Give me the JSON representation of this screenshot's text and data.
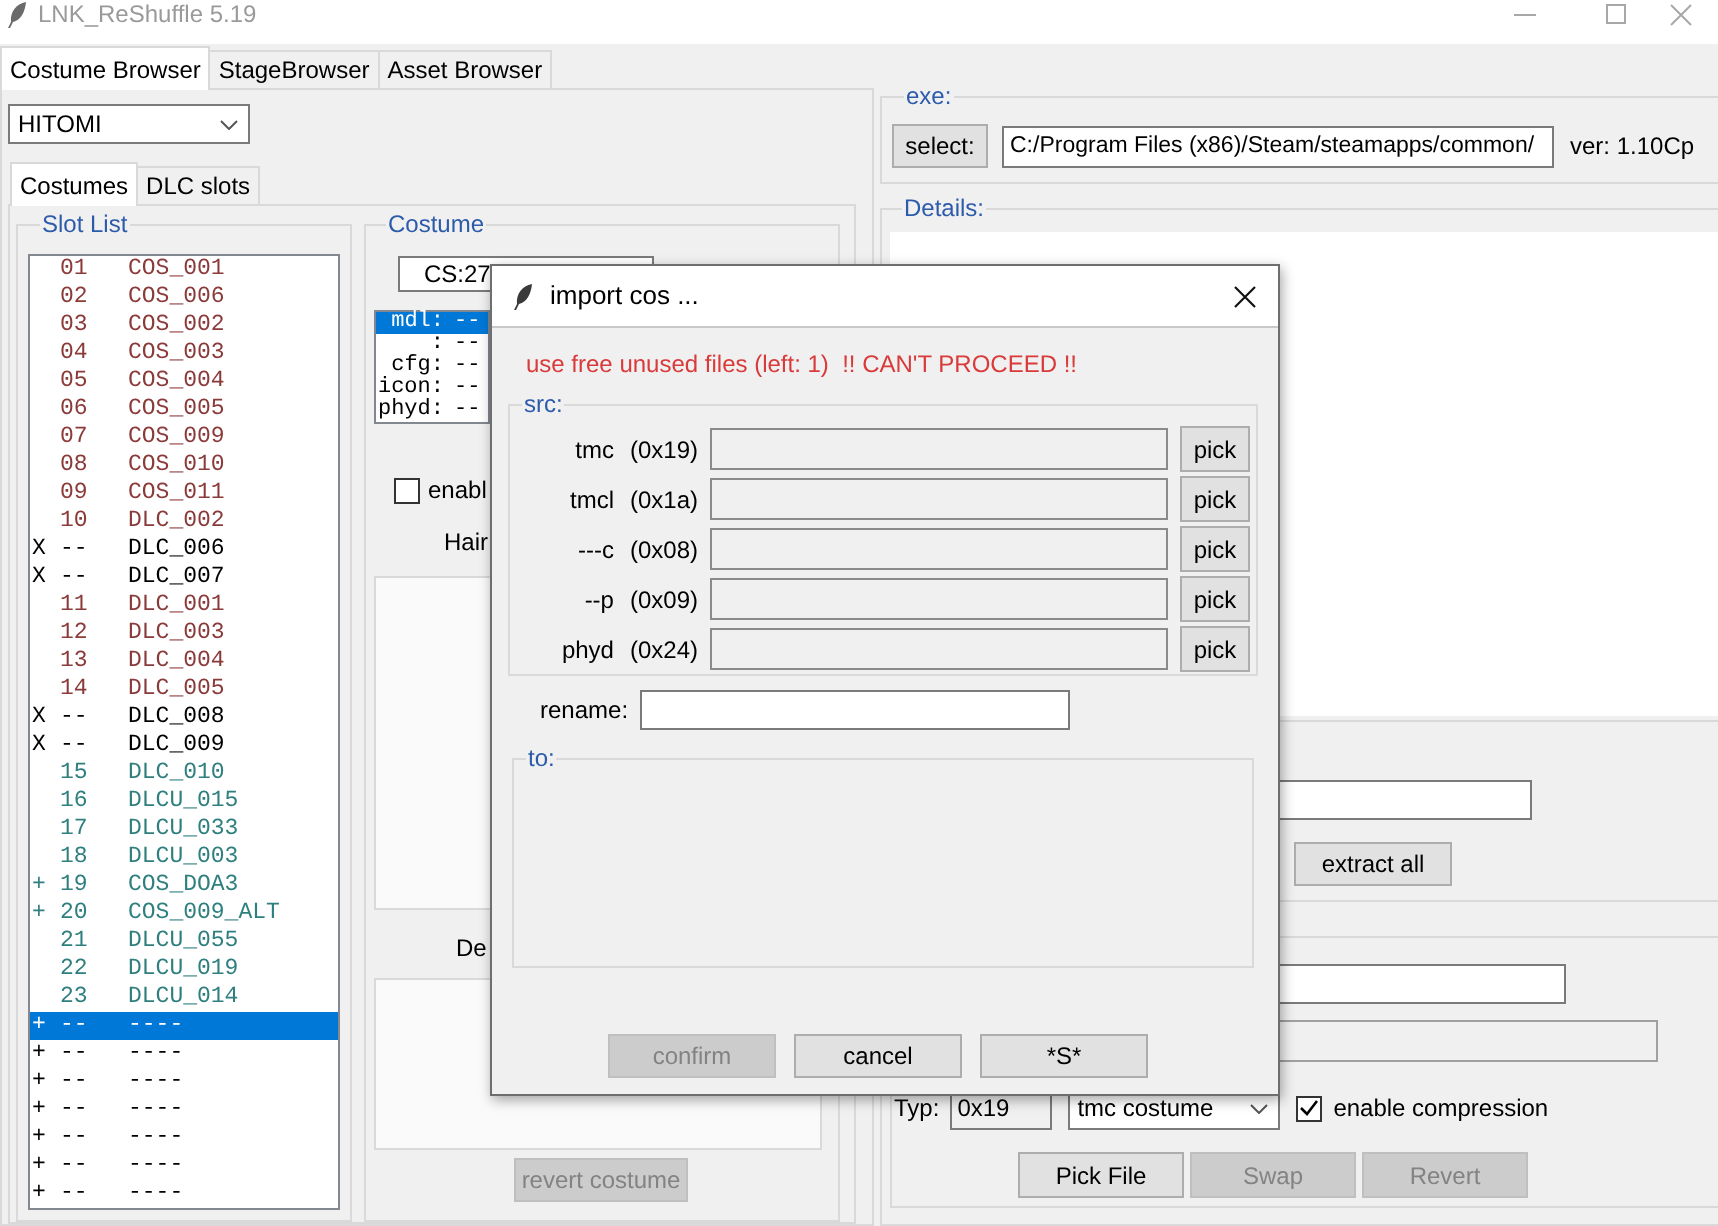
{
  "window": {
    "title": "LNK_ReShuffle 5.19",
    "active": false
  },
  "main_tabs": [
    {
      "label": "Costume Browser",
      "selected": true
    },
    {
      "label": "StageBrowser",
      "selected": false
    },
    {
      "label": "Asset Browser",
      "selected": false
    }
  ],
  "character_dropdown": {
    "value": "HITOMI"
  },
  "sub_tabs": [
    {
      "label": "Costumes",
      "selected": true
    },
    {
      "label": "DLC slots",
      "selected": false
    }
  ],
  "slot_list": {
    "title": "Slot List",
    "rows": [
      {
        "number": "01",
        "name": "COS_001",
        "color": "#8b3a3a",
        "selected": false
      },
      {
        "number": "02",
        "name": "COS_006",
        "color": "#8b3a3a",
        "selected": false
      },
      {
        "number": "03",
        "name": "COS_002",
        "color": "#8b3a3a",
        "selected": false
      },
      {
        "number": "04",
        "name": "COS_003",
        "color": "#8b3a3a",
        "selected": false
      },
      {
        "number": "05",
        "name": "COS_004",
        "color": "#8b3a3a",
        "selected": false
      },
      {
        "number": "06",
        "name": "COS_005",
        "color": "#8b3a3a",
        "selected": false
      },
      {
        "number": "07",
        "name": "COS_009",
        "color": "#8b3a3a",
        "selected": false
      },
      {
        "number": "08",
        "name": "COS_010",
        "color": "#8b3a3a",
        "selected": false
      },
      {
        "number": "09",
        "name": "COS_011",
        "color": "#8b3a3a",
        "selected": false
      },
      {
        "number": "10",
        "name": "DLC_002",
        "color": "#8b3a3a",
        "selected": false
      },
      {
        "flag": "X",
        "number": "--",
        "name": "DLC_006",
        "color": "#000000",
        "selected": false
      },
      {
        "flag": "X",
        "number": "--",
        "name": "DLC_007",
        "color": "#000000",
        "selected": false
      },
      {
        "number": "11",
        "name": "DLC_001",
        "color": "#8b3a3a",
        "selected": false
      },
      {
        "number": "12",
        "name": "DLC_003",
        "color": "#8b3a3a",
        "selected": false
      },
      {
        "number": "13",
        "name": "DLC_004",
        "color": "#8b3a3a",
        "selected": false
      },
      {
        "number": "14",
        "name": "DLC_005",
        "color": "#8b3a3a",
        "selected": false
      },
      {
        "flag": "X",
        "number": "--",
        "name": "DLC_008",
        "color": "#000000",
        "selected": false
      },
      {
        "flag": "X",
        "number": "--",
        "name": "DLC_009",
        "color": "#000000",
        "selected": false
      },
      {
        "number": "15",
        "name": "DLC_010",
        "color": "#2f7f7f",
        "selected": false
      },
      {
        "number": "16",
        "name": "DLCU_015",
        "color": "#2f7f7f",
        "selected": false
      },
      {
        "number": "17",
        "name": "DLCU_033",
        "color": "#2f7f7f",
        "selected": false
      },
      {
        "number": "18",
        "name": "DLCU_003",
        "color": "#2f7f7f",
        "selected": false
      },
      {
        "flag": "+",
        "number": "19",
        "name": "COS_DOA3",
        "color": "#2f7f7f",
        "selected": false
      },
      {
        "flag": "+",
        "number": "20",
        "name": "COS_009_ALT",
        "color": "#2f7f7f",
        "selected": false
      },
      {
        "number": "21",
        "name": "DLCU_055",
        "color": "#2f7f7f",
        "selected": false
      },
      {
        "number": "22",
        "name": "DLCU_019",
        "color": "#2f7f7f",
        "selected": false
      },
      {
        "number": "23",
        "name": "DLCU_014",
        "color": "#2f7f7f",
        "selected": false
      },
      {
        "flag": "+",
        "number": "--",
        "name": "----",
        "selected": true
      },
      {
        "flag": "+",
        "number": "--",
        "name": "----",
        "color": "#000000",
        "selected": false
      },
      {
        "flag": "+",
        "number": "--",
        "name": "----",
        "color": "#000000",
        "selected": false
      },
      {
        "flag": "+",
        "number": "--",
        "name": "----",
        "color": "#000000",
        "selected": false
      },
      {
        "flag": "+",
        "number": "--",
        "name": "----",
        "color": "#000000",
        "selected": false
      },
      {
        "flag": "+",
        "number": "--",
        "name": "----",
        "color": "#000000",
        "selected": false
      },
      {
        "flag": "+",
        "number": "--",
        "name": "----",
        "color": "#000000",
        "selected": false
      }
    ]
  },
  "costume": {
    "title": "Costume",
    "id_dropdown": {
      "value": "CS:27"
    },
    "files": [
      {
        "key": "mdl:",
        "value": "--",
        "selected": true
      },
      {
        "key": ":",
        "value": "--",
        "selected": false
      },
      {
        "key": "cfg:",
        "value": "--",
        "selected": false
      },
      {
        "key": "icon:",
        "value": "--",
        "selected": false
      },
      {
        "key": "phyd:",
        "value": "--",
        "selected": false
      }
    ],
    "checkbox": {
      "label": "enabl",
      "checked": false
    },
    "upper_box_label": "Hair",
    "lower_box_label": "De",
    "revert_button": {
      "label": "revert costume",
      "disabled": true
    }
  },
  "exe": {
    "title": "exe:",
    "select_button": "select:",
    "path": "C:/Program Files (x86)/Steam/steamapps/common/",
    "version": "ver: 1.10Cp"
  },
  "details": {
    "title": "Details:",
    "extract_button": "extract all",
    "type_label": "Typ:",
    "type_code": "0x19",
    "type_dropdown": "tmc costume",
    "compression": {
      "label": "enable compression",
      "checked": true
    },
    "buttons": [
      {
        "label": "Pick File",
        "disabled": false
      },
      {
        "label": "Swap",
        "disabled": true
      },
      {
        "label": "Revert",
        "disabled": true
      }
    ]
  },
  "dialog": {
    "title": "import cos ...",
    "warning": "use free unused files (left: 1)  !! CAN'T PROCEED !!",
    "src_title": "src:",
    "sources": [
      {
        "name": "tmc",
        "code": "(0x19)",
        "button": "pick"
      },
      {
        "name": "tmcl",
        "code": "(0x1a)",
        "button": "pick"
      },
      {
        "name": "---c",
        "code": "(0x08)",
        "button": "pick"
      },
      {
        "name": "--p",
        "code": "(0x09)",
        "button": "pick"
      },
      {
        "name": "phyd",
        "code": "(0x24)",
        "button": "pick"
      }
    ],
    "rename_label": "rename:",
    "to_title": "to:",
    "buttons": [
      {
        "label": "confirm",
        "disabled": true
      },
      {
        "label": "cancel",
        "disabled": false
      },
      {
        "label": "*S*",
        "disabled": false
      }
    ]
  }
}
